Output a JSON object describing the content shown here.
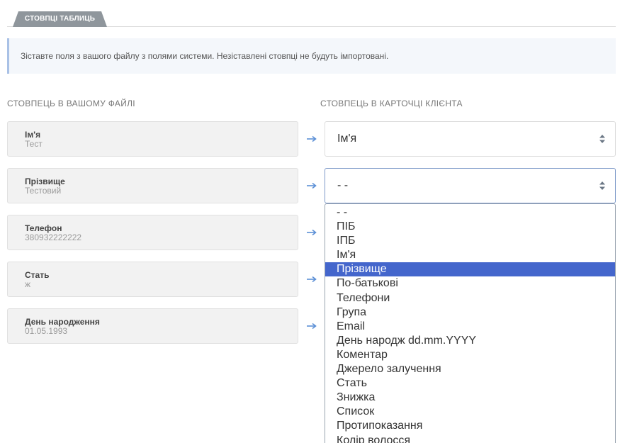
{
  "tabs": {
    "active_label": "СТОВПЦІ ТАБЛИЦЬ"
  },
  "info": {
    "message": "Зіставте поля з вашого файлу з полями системи. Незіставлені стовпці не будуть імпортовані."
  },
  "columns": {
    "left_header": "СТОВПЕЦЬ В ВАШОМУ ФАЙЛІ",
    "right_header": "СТОВПЕЦЬ В КАРТОЧЦІ КЛІЄНТА"
  },
  "fields": [
    {
      "name": "Ім'я",
      "sample": "Тест"
    },
    {
      "name": "Прізвище",
      "sample": "Тестовий"
    },
    {
      "name": "Телефон",
      "sample": "380932222222"
    },
    {
      "name": "Стать",
      "sample": "ж"
    },
    {
      "name": "День народження",
      "sample": "01.05.1993"
    }
  ],
  "mappings": [
    {
      "value": "Ім'я"
    },
    {
      "value": "- -"
    }
  ],
  "dropdown": {
    "selected_index": 4,
    "options": [
      "- -",
      "ПІБ",
      "ІПБ",
      "Ім'я",
      "Прізвище",
      "По-батькові",
      "Телефони",
      "Група",
      "Email",
      "День народж dd.mm.YYYY",
      "Коментар",
      "Джерело залучення",
      "Стать",
      "Знижка",
      "Список",
      "Протипоказання",
      "Колір волосся"
    ]
  },
  "colors": {
    "accent": "#4466cc",
    "arrow": "#5b8fd6",
    "tab": "#8f969c"
  }
}
